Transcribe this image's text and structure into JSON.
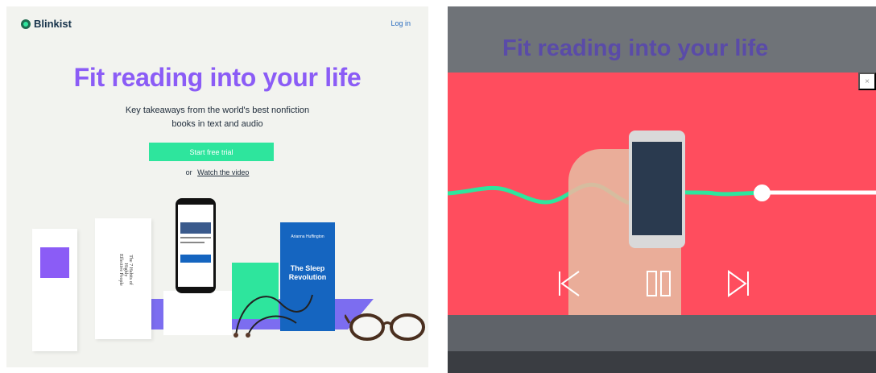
{
  "left": {
    "logo_text": "Blinkist",
    "login_label": "Log in",
    "headline": "Fit reading into your life",
    "subtitle_line1": "Key takeaways from the world's best nonfiction",
    "subtitle_line2": "books in text and audio",
    "cta_label": "Start free trial",
    "or_text": "or",
    "watch_label": "Watch the video",
    "book1_title": "The 7 Habits of Highly Effective People",
    "book2_author": "Arianna Huffington",
    "book2_title": "The Sleep Revolution"
  },
  "right": {
    "headline": "Fit reading into your life",
    "close_label": "×",
    "controls": {
      "prev_icon": "skip-previous-icon",
      "pause_icon": "pause-icon",
      "next_icon": "skip-next-icon"
    },
    "progress": 0.73
  },
  "colors": {
    "brand_green": "#2ee59d",
    "headline_purple": "#8b5cf6",
    "modal_red": "#ff4d5e",
    "login_blue": "#2a6cbf"
  }
}
